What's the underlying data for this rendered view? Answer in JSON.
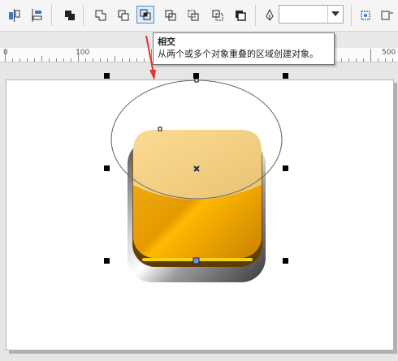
{
  "toolbar": {
    "buttons": [
      {
        "name": "align-center-icon"
      },
      {
        "name": "distribute-icon"
      },
      {
        "name": "combine-icon"
      },
      {
        "name": "weld-icon"
      },
      {
        "name": "trim-icon"
      },
      {
        "name": "intersect-icon",
        "active": true
      },
      {
        "name": "simplify-icon"
      },
      {
        "name": "front-minus-back-icon"
      },
      {
        "name": "back-minus-front-icon"
      },
      {
        "name": "create-boundary-icon"
      },
      {
        "name": "pen-nib-icon"
      },
      {
        "name": "snap-icon"
      },
      {
        "name": "options-icon"
      }
    ],
    "outline_width_value": ""
  },
  "tooltip": {
    "title": "相交",
    "description": "从两个或多个对象重叠的区域创建对象。"
  },
  "ruler": {
    "labels": [
      "0",
      "100",
      "500"
    ]
  },
  "colors": {
    "accent": "#4a8fd6",
    "arrow_red": "#e8322a",
    "button_orange": "#f2a600",
    "button_light": "#f5cf7d"
  }
}
